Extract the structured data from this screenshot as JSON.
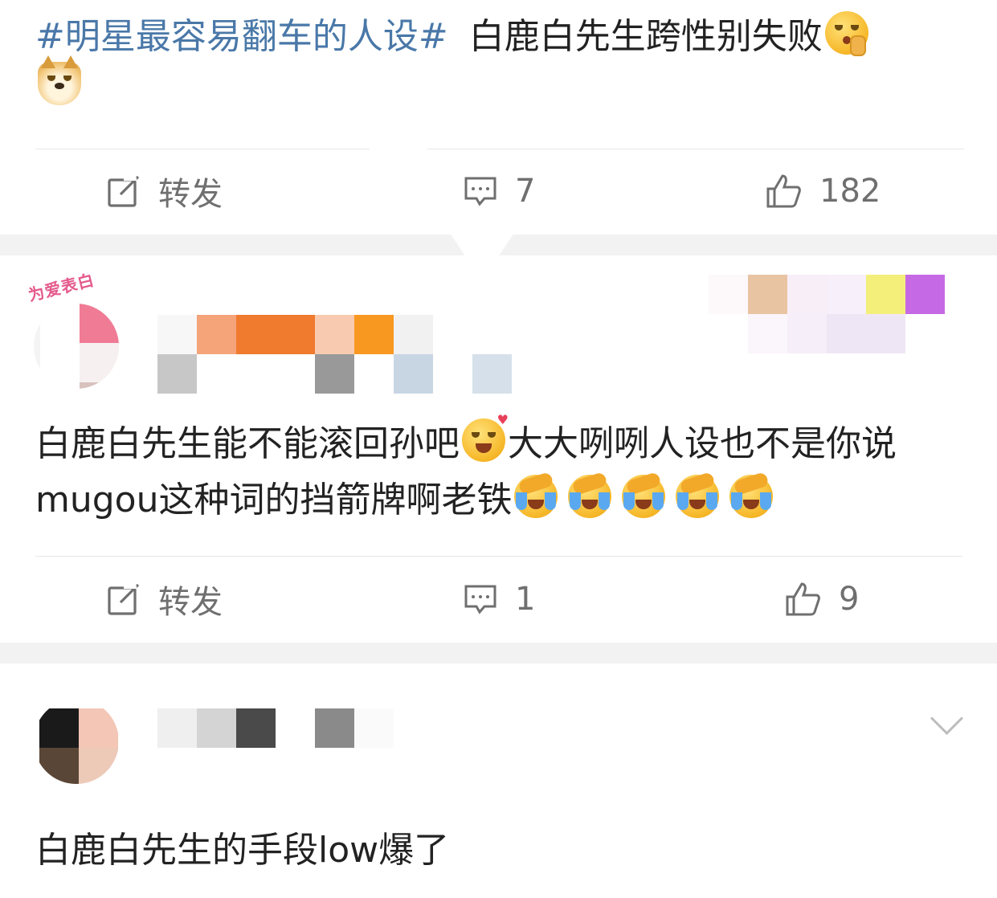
{
  "post": {
    "hashtag": "#明星最容易翻车的人设#",
    "text": "白鹿白先生跨性别失败",
    "emoji_1": "shush-face-emoji",
    "emoji_2": "doge-emoji"
  },
  "post_actions": {
    "repost_label": "转发",
    "comment_count": "7",
    "like_count": "182"
  },
  "comments": [
    {
      "badge": "为爱表白",
      "text_part1": "白鹿白先生能不能滚回孙吧",
      "text_part2": "大大咧咧人设也不是你说mugou这种词的挡箭牌啊老铁",
      "emoji_love": "love-face-emoji",
      "emoji_cry": "laugh-cry-emoji",
      "actions": {
        "repost_label": "转发",
        "comment_count": "1",
        "like_count": "9"
      }
    },
    {
      "text": "白鹿白先生的手段low爆了"
    }
  ],
  "colors": {
    "hashtag": "#4a78a8",
    "text": "#222222",
    "action_gray": "#6f6f6f",
    "separator": "#f2f2f2"
  }
}
